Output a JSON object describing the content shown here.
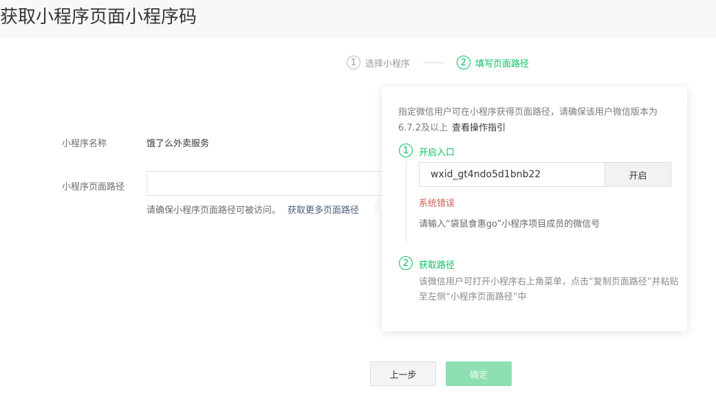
{
  "page": {
    "title": "获取小程序页面小程序码"
  },
  "steps": [
    {
      "num": "1",
      "label": "选择小程序"
    },
    {
      "num": "2",
      "label": "填写页面路径"
    }
  ],
  "form": {
    "name_label": "小程序名称",
    "name_value": "饿了么外卖服务",
    "path_label": "小程序页面路径",
    "path_value": "",
    "hint": "请确保小程序页面路径可被访问。",
    "hint_link": "获取更多页面路径"
  },
  "popover": {
    "desc": "指定微信用户可在小程序获得页面路径，请确保该用户微信版本为6.7.2及以上",
    "desc_link": "查看操作指引",
    "step1": {
      "num": "1",
      "title": "开启入口",
      "input_value": "wxid_gt4ndo5d1bnb22",
      "button": "开启",
      "error": "系统错误",
      "error_tip": "请输入“袋鼠食惠go”小程序项目成员的微信号"
    },
    "step2": {
      "num": "2",
      "title": "获取路径",
      "desc": "该微信用户可打开小程序右上角菜单，点击“复制页面路径”并粘贴至左侧“小程序页面路径”中"
    }
  },
  "buttons": {
    "prev": "上一步",
    "ok": "确定"
  },
  "colors": {
    "accent": "#07c160",
    "error": "#d05b4d",
    "disabled_ok": "#8ee0b1"
  }
}
